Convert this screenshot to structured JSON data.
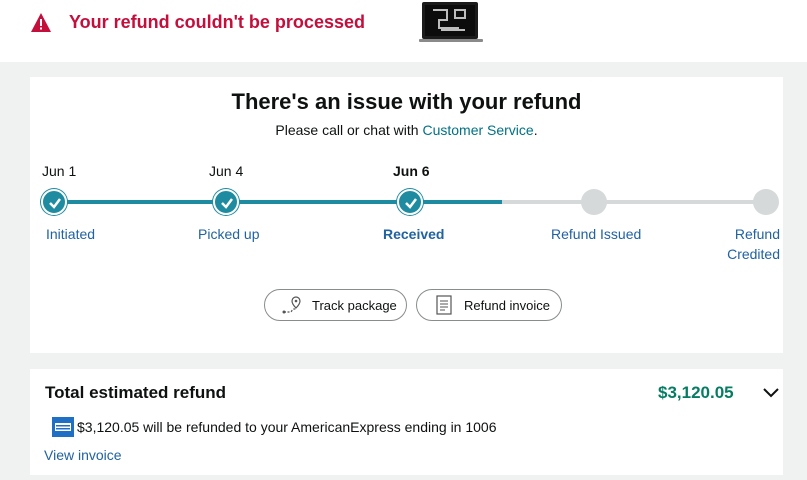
{
  "alert": {
    "title": "Your refund couldn't be processed",
    "icon": "warning-triangle-icon",
    "color": "#c40f3c"
  },
  "product": {
    "icon": "laptop-thumbnail-icon"
  },
  "status_card": {
    "title": "There's an issue with your refund",
    "subtitle_prefix": "Please call or chat with ",
    "subtitle_link": "Customer Service",
    "subtitle_suffix": ".",
    "steps": [
      {
        "date": "Jun 1",
        "label": "Initiated",
        "state": "done"
      },
      {
        "date": "Jun 4",
        "label": "Picked up",
        "state": "done"
      },
      {
        "date": "Jun 6",
        "label": "Received",
        "state": "current"
      },
      {
        "date": "",
        "label": "Refund Issued",
        "state": "todo"
      },
      {
        "date": "",
        "label": "Refund",
        "label2": "Credited",
        "state": "todo"
      }
    ],
    "buttons": {
      "track": "Track package",
      "invoice": "Refund invoice"
    },
    "colors": {
      "progress": "#1f8ba0",
      "pending": "#d5d9d9",
      "link": "#2162a1"
    }
  },
  "refund_card": {
    "title": "Total estimated refund",
    "amount": "$3,120.05",
    "description": "$3,120.05 will be refunded to your AmericanExpress ending in 1006",
    "card_icon": "amex-card-icon",
    "view_invoice": "View invoice",
    "amount_color": "#067d62"
  }
}
